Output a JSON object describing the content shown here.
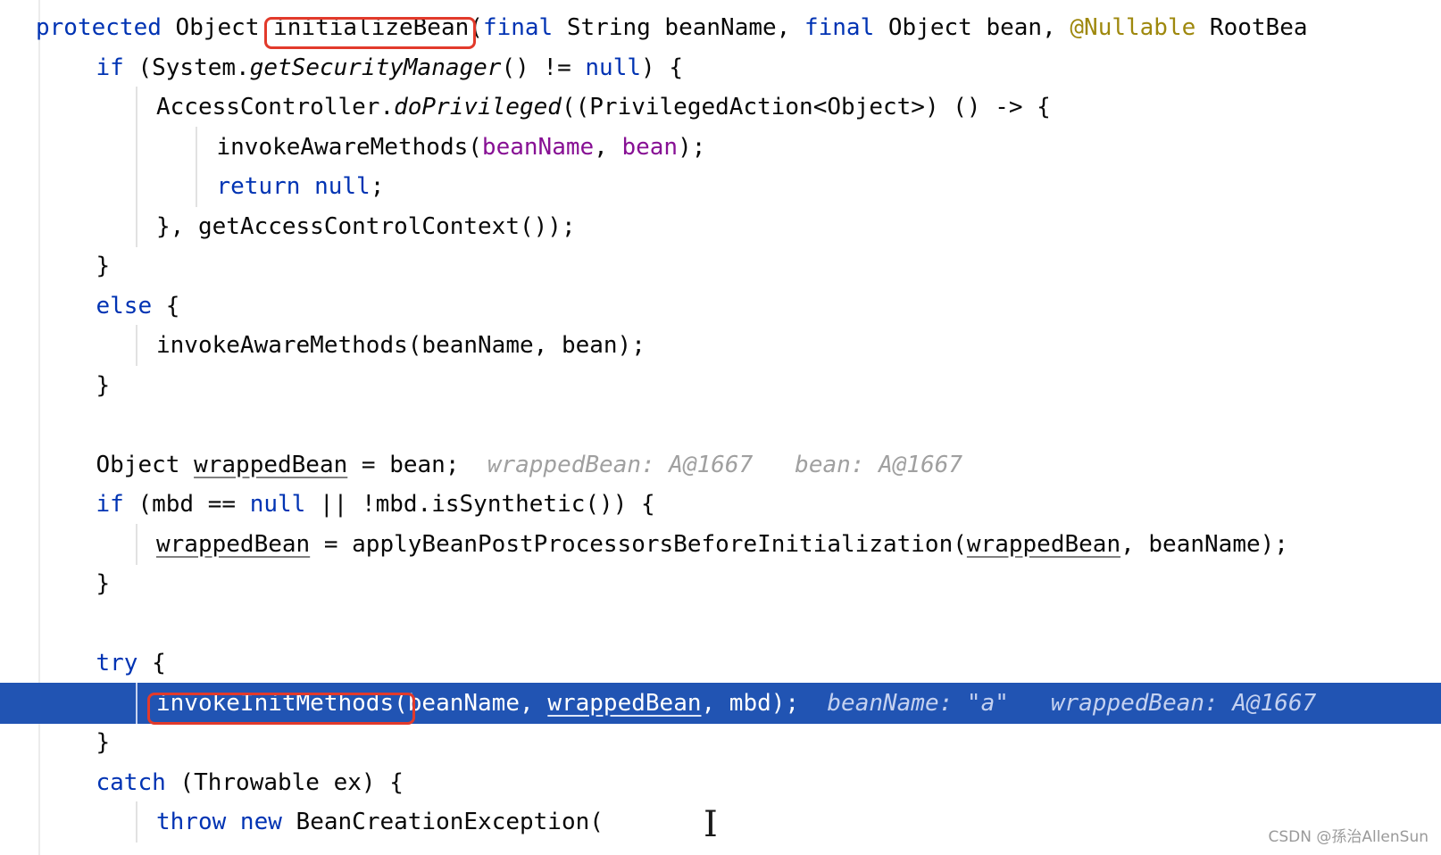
{
  "code": {
    "lines": [
      {
        "indent": 0,
        "parts": [
          {
            "t": "protected ",
            "c": "kw"
          },
          {
            "t": "Object "
          },
          {
            "t": "initializeBean",
            "c": "fn-decl",
            "box": true
          },
          {
            "t": "("
          },
          {
            "t": "final ",
            "c": "kw"
          },
          {
            "t": "String beanName, "
          },
          {
            "t": "final ",
            "c": "kw"
          },
          {
            "t": "Object bean, "
          },
          {
            "t": "@Nullable",
            "c": "ann"
          },
          {
            "t": " RootBea"
          }
        ]
      },
      {
        "indent": 1,
        "parts": [
          {
            "t": "if ",
            "c": "kw"
          },
          {
            "t": "(System."
          },
          {
            "t": "getSecurityManager",
            "c": "italic"
          },
          {
            "t": "() != "
          },
          {
            "t": "null",
            "c": "kw"
          },
          {
            "t": ") {"
          }
        ]
      },
      {
        "indent": 2,
        "parts": [
          {
            "t": "AccessController."
          },
          {
            "t": "doPrivileged",
            "c": "italic"
          },
          {
            "t": "((PrivilegedAction<Object>) () -> {"
          }
        ]
      },
      {
        "indent": 3,
        "parts": [
          {
            "t": "invokeAwareMethods("
          },
          {
            "t": "beanName",
            "c": "fld"
          },
          {
            "t": ", "
          },
          {
            "t": "bean",
            "c": "fld"
          },
          {
            "t": ");"
          }
        ]
      },
      {
        "indent": 3,
        "parts": [
          {
            "t": "return ",
            "c": "kw"
          },
          {
            "t": "null",
            "c": "kw"
          },
          {
            "t": ";"
          }
        ]
      },
      {
        "indent": 2,
        "parts": [
          {
            "t": "}, getAccessControlContext());"
          }
        ]
      },
      {
        "indent": 1,
        "parts": [
          {
            "t": "}"
          }
        ]
      },
      {
        "indent": 1,
        "parts": [
          {
            "t": "else ",
            "c": "kw"
          },
          {
            "t": "{"
          }
        ]
      },
      {
        "indent": 2,
        "parts": [
          {
            "t": "invokeAwareMethods(beanName, bean);"
          }
        ]
      },
      {
        "indent": 1,
        "parts": [
          {
            "t": "}"
          }
        ]
      },
      {
        "indent": 0,
        "parts": []
      },
      {
        "indent": 1,
        "parts": [
          {
            "t": "Object "
          },
          {
            "t": "wrappedBean",
            "c": "ul"
          },
          {
            "t": " = bean;  "
          },
          {
            "t": "wrappedBean: A@1667   bean: A@1667",
            "c": "hint"
          }
        ]
      },
      {
        "indent": 1,
        "parts": [
          {
            "t": "if ",
            "c": "kw"
          },
          {
            "t": "(mbd == "
          },
          {
            "t": "null",
            "c": "kw"
          },
          {
            "t": " || !mbd.isSynthetic()) {"
          }
        ]
      },
      {
        "indent": 2,
        "parts": [
          {
            "t": "wrappedBean",
            "c": "ul"
          },
          {
            "t": " = applyBeanPostProcessorsBeforeInitialization("
          },
          {
            "t": "wrappedBean",
            "c": "ul"
          },
          {
            "t": ", beanName);"
          }
        ]
      },
      {
        "indent": 1,
        "parts": [
          {
            "t": "}"
          }
        ]
      },
      {
        "indent": 0,
        "parts": []
      },
      {
        "indent": 1,
        "parts": [
          {
            "t": "try ",
            "c": "kw"
          },
          {
            "t": "{"
          }
        ]
      },
      {
        "indent": 2,
        "exec": true,
        "parts": [
          {
            "t": "invokeInitMethods(",
            "box": true
          },
          {
            "t": "beanName, "
          },
          {
            "t": "wrappedBean",
            "c": "ul"
          },
          {
            "t": ", mbd);  "
          },
          {
            "t": "beanName: \"a\"   wrappedBean: A@1667",
            "c": "hint"
          }
        ]
      },
      {
        "indent": 1,
        "parts": [
          {
            "t": "}"
          }
        ]
      },
      {
        "indent": 1,
        "parts": [
          {
            "t": "catch ",
            "c": "kw"
          },
          {
            "t": "(Throwable ex) {"
          }
        ]
      },
      {
        "indent": 2,
        "parts": [
          {
            "t": "throw new ",
            "c": "kw"
          },
          {
            "t": "BeanCreationException("
          }
        ]
      }
    ]
  },
  "watermark": "CSDN @孫治AllenSun"
}
